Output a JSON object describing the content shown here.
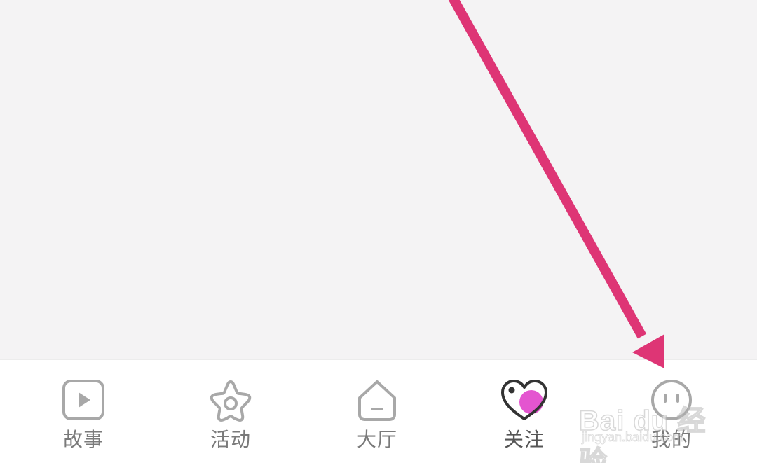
{
  "tabbar": {
    "tabs": [
      {
        "id": "story",
        "label": "故事",
        "icon": "play-square-icon"
      },
      {
        "id": "activity",
        "label": "活动",
        "icon": "star-icon"
      },
      {
        "id": "hall",
        "label": "大厅",
        "icon": "home-icon"
      },
      {
        "id": "follow",
        "label": "关注",
        "icon": "heart-icon",
        "active": true
      },
      {
        "id": "mine",
        "label": "我的",
        "icon": "face-icon"
      }
    ]
  },
  "colors": {
    "background": "#f4f3f4",
    "tabbar_bg": "#ffffff",
    "label_color": "#7a7a7a",
    "icon_gray": "#a8a8a8",
    "active_heart_outline": "#333333",
    "active_heart_fill": "#e455d0",
    "annotation_arrow": "#de3575"
  },
  "watermark": {
    "brand": "Bai du 经验",
    "url": "jingyan.baidu.com"
  }
}
